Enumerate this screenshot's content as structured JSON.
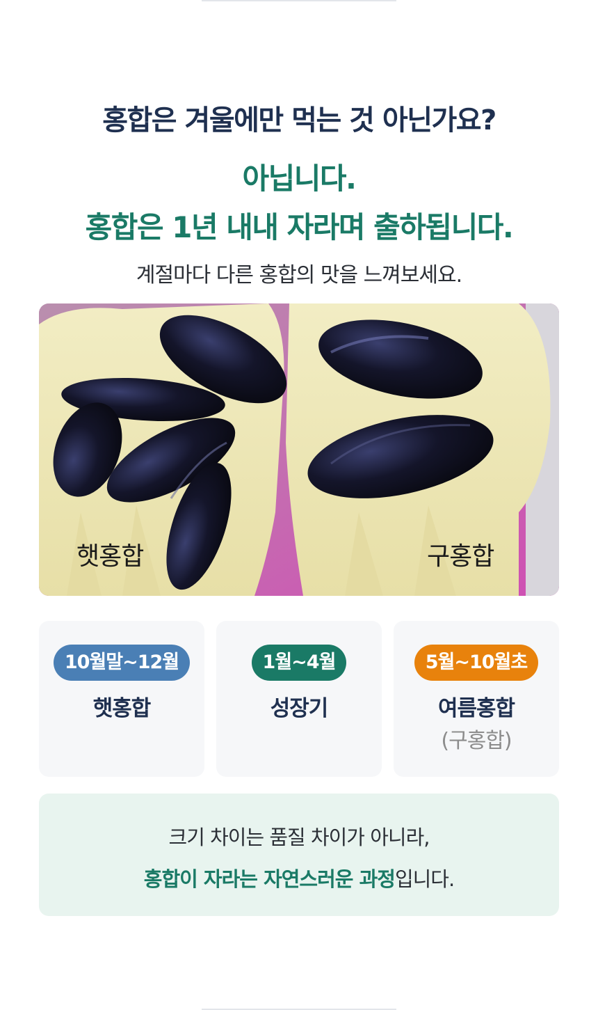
{
  "heading": {
    "question": "홍합은 겨울에만 먹는 것 아닌가요?",
    "answer_line1": "아닙니다.",
    "answer_line2": "홍합은 1년 내내 자라며 출하됩니다.",
    "subtitle": "계절마다 다른 홍합의 맛을 느껴보세요."
  },
  "photo": {
    "label_left": "햇홍합",
    "label_right": "구홍합"
  },
  "seasons": [
    {
      "period": "10월말~12월",
      "title": "햇홍합",
      "subtitle": "",
      "color": "#4a7fb5"
    },
    {
      "period": "1월~4월",
      "title": "성장기",
      "subtitle": "",
      "color": "#1a7a66"
    },
    {
      "period": "5월~10월초",
      "title": "여름홍합",
      "subtitle": "(구홍합)",
      "color": "#e8820c"
    }
  ],
  "note": {
    "line1": "크기 차이는 품질 차이가 아니라,",
    "line2_emphasis": "홍합이 자라는 자연스러운 과정",
    "line2_suffix": "입니다."
  },
  "colors": {
    "navy": "#1f3050",
    "green": "#1a7a66",
    "note_bg": "#e8f4ef"
  }
}
